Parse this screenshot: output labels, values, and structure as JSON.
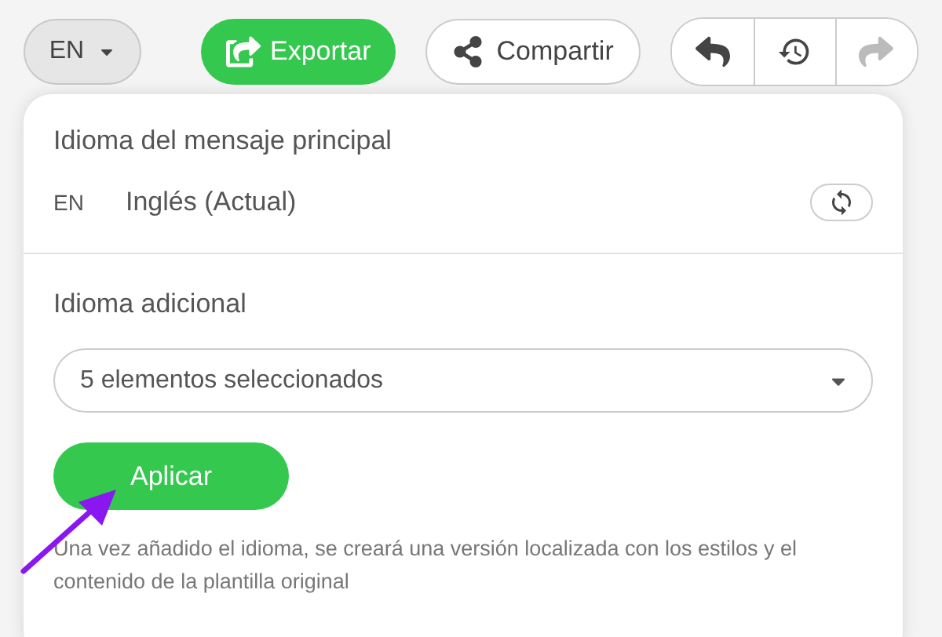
{
  "toolbar": {
    "language_button": {
      "label": "EN",
      "expanded": true
    },
    "export_button": {
      "label": "Exportar"
    },
    "share_button": {
      "label": "Compartir"
    },
    "history_buttons": [
      {
        "kind": "undo",
        "disabled": false
      },
      {
        "kind": "history",
        "disabled": false
      },
      {
        "kind": "redo",
        "disabled": true
      }
    ]
  },
  "language_panel": {
    "main_language": {
      "title": "Idioma del mensaje principal",
      "code": "EN",
      "name": "Inglés (Actual)"
    },
    "additional_language": {
      "title": "Idioma adicional",
      "value": "5 elementos seleccionados"
    },
    "apply_button": {
      "label": "Aplicar"
    },
    "help_text": "Una vez añadido el idioma, se creará una versión localizada con los estilos y el contenido de la plantilla original"
  }
}
